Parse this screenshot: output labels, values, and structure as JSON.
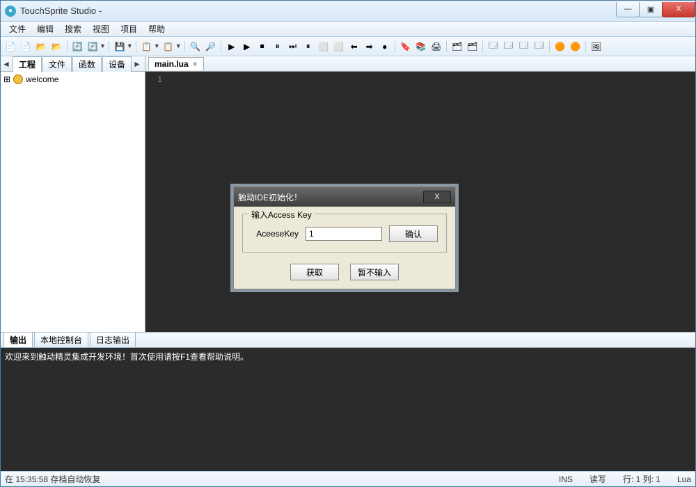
{
  "window": {
    "title": "TouchSprite Studio -"
  },
  "menu": [
    "文件",
    "编辑",
    "搜索",
    "视图",
    "项目",
    "帮助"
  ],
  "sidebar": {
    "tabs": [
      "工程",
      "文件",
      "函数",
      "设备"
    ],
    "active": 0,
    "tree": {
      "root": "welcome"
    }
  },
  "editor": {
    "tab": "main.lua",
    "line_number": "1"
  },
  "output": {
    "tabs": [
      "输出",
      "本地控制台",
      "日志输出"
    ],
    "active": 0,
    "text": "欢迎来到触动精灵集成开发环境！首次使用请按F1查看帮助说明。"
  },
  "status": {
    "left": "在 15:35:58 存档自动恢复",
    "ins": "INS",
    "rw": "读写",
    "pos": "行: 1 列: 1",
    "lang": "Lua"
  },
  "dialog": {
    "title": "触动IDE初始化！",
    "fieldset": "输入Access Key",
    "label": "AceeseKey",
    "value": "1",
    "confirm": "确认",
    "get": "获取",
    "skip": "暂不输入"
  },
  "winbtns": {
    "min": "—",
    "max": "▣",
    "close": "X"
  },
  "toolbar_icons": [
    "📄",
    "📄",
    "📂",
    "📂",
    "|",
    "🔄",
    "🔄",
    "▾",
    "|",
    "💾",
    "▾",
    "|",
    "📋",
    "▾",
    "📋",
    "▾",
    "|",
    "🔍",
    "🔎",
    "|",
    "▶",
    "▶",
    "⏹",
    "⏸",
    "⏭",
    "⏸",
    "⬜",
    "⬜",
    "⬅",
    "➡",
    "●",
    "|",
    "🔖",
    "📚",
    "🖨",
    "|",
    "🗂",
    "🗂",
    "|",
    "🗔",
    "🗔",
    "🗔",
    "🗔",
    "|",
    "🟠",
    "🟠",
    "|",
    "🖼"
  ]
}
